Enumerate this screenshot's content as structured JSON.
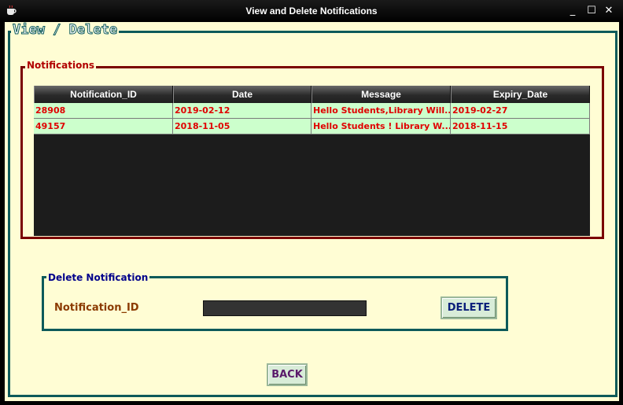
{
  "window": {
    "title": "View and Delete Notifications",
    "minimize_glyph": "_",
    "maximize_glyph": "☐",
    "close_glyph": "✕",
    "app_icon": "coffee-cup-icon"
  },
  "panel": {
    "title": "View / Delete"
  },
  "notifications": {
    "title": "Notifications",
    "columns": [
      "Notification_ID",
      "Date",
      "Message",
      "Expiry_Date"
    ],
    "rows": [
      [
        "28908",
        "2019-02-12",
        "Hello Students,Library Will...",
        "2019-02-27"
      ],
      [
        "49157",
        "2018-11-05",
        "Hello Students ! Library W...",
        "2018-11-15"
      ]
    ]
  },
  "delete_section": {
    "title": "Delete Notification",
    "field_label": "Notification_ID",
    "field_value": "",
    "delete_label": "DELETE"
  },
  "back_label": "BACK",
  "colors": {
    "background": "#fffdd4",
    "teal_border": "#0d5a5a",
    "maroon_border": "#7a0000",
    "row_bg": "#ccffcc",
    "row_text": "#e00000"
  }
}
